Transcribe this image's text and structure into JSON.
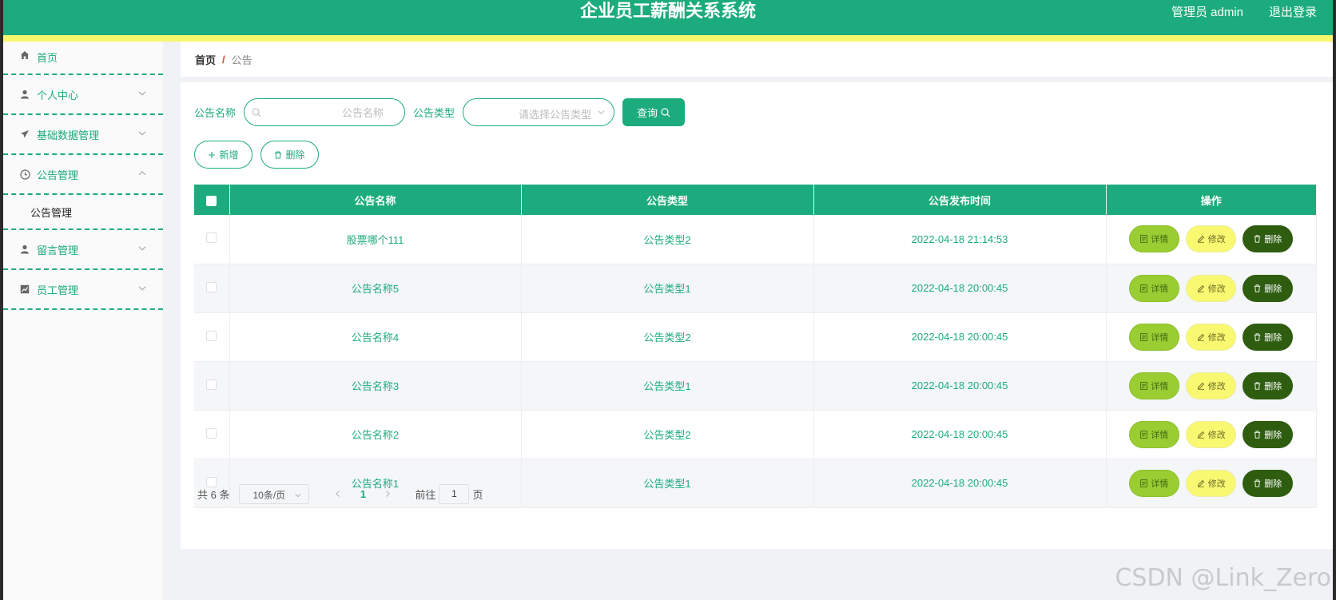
{
  "header": {
    "title": "企业员工薪酬关系系统",
    "user": "管理员 admin",
    "logout": "退出登录"
  },
  "sidebar": {
    "items": [
      {
        "label": "首页",
        "icon": "home-icon"
      },
      {
        "label": "个人中心",
        "icon": "user-icon"
      },
      {
        "label": "基础数据管理",
        "icon": "send-icon"
      },
      {
        "label": "公告管理",
        "icon": "clock-icon",
        "expanded": true
      },
      {
        "label": "留言管理",
        "icon": "user-icon"
      },
      {
        "label": "员工管理",
        "icon": "chart-icon"
      }
    ],
    "submenu": "公告管理"
  },
  "breadcrumb": {
    "home": "首页",
    "separator": "/",
    "current": "公告"
  },
  "search": {
    "name_label": "公告名称",
    "name_placeholder": "公告名称",
    "type_label": "公告类型",
    "type_placeholder": "请选择公告类型",
    "query_label": "查询"
  },
  "actions": {
    "add": "新增",
    "delete": "删除"
  },
  "table": {
    "headers": [
      "公告名称",
      "公告类型",
      "公告发布时间",
      "操作"
    ],
    "rows": [
      {
        "name": "股票哪个111",
        "type": "公告类型2",
        "time": "2022-04-18 21:14:53"
      },
      {
        "name": "公告名称5",
        "type": "公告类型1",
        "time": "2022-04-18 20:00:45"
      },
      {
        "name": "公告名称4",
        "type": "公告类型2",
        "time": "2022-04-18 20:00:45"
      },
      {
        "name": "公告名称3",
        "type": "公告类型1",
        "time": "2022-04-18 20:00:45"
      },
      {
        "name": "公告名称2",
        "type": "公告类型2",
        "time": "2022-04-18 20:00:45"
      },
      {
        "name": "公告名称1",
        "type": "公告类型1",
        "time": "2022-04-18 20:00:45"
      }
    ],
    "ops": {
      "detail": "详情",
      "edit": "修改",
      "delete": "删除"
    }
  },
  "pagination": {
    "total": "共 6 条",
    "page_size": "10条/页",
    "current_page": "1",
    "goto_label": "前往",
    "goto_value": "1",
    "page_suffix": "页"
  },
  "watermark": "CSDN @Link_Zero",
  "colors": {
    "primary": "#1cab7c",
    "stripe": "#f7f76b",
    "detail": "#9acd32",
    "edit": "#f9f871",
    "delete": "#2e5d10"
  }
}
